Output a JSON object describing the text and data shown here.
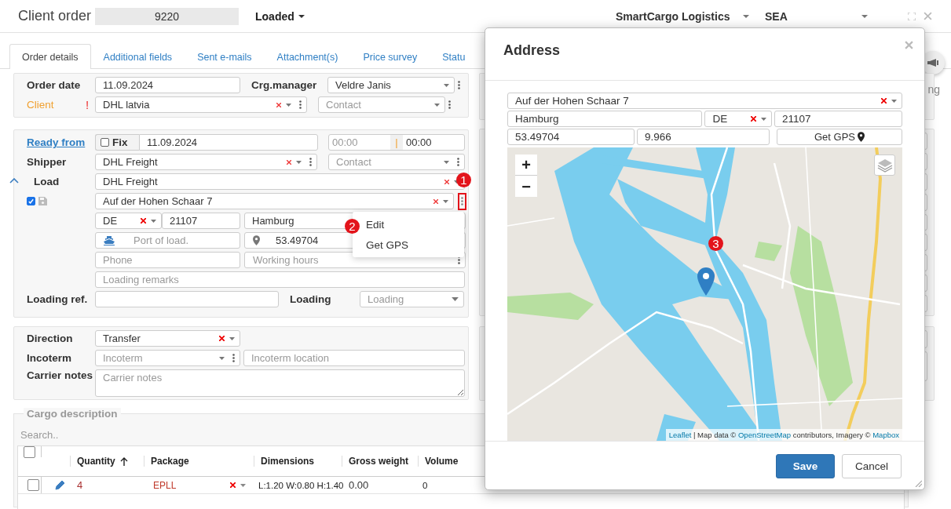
{
  "header": {
    "title": "Client order",
    "order_number": "9220",
    "status": "Loaded",
    "company": "SmartCargo Logistics",
    "mode": "SEA"
  },
  "tabs": [
    {
      "label": "Order details",
      "selected": true
    },
    {
      "label": "Additional fields",
      "selected": false
    },
    {
      "label": "Sent e-mails",
      "selected": false
    },
    {
      "label": "Attachment(s)",
      "selected": false
    },
    {
      "label": "Price survey",
      "selected": false
    },
    {
      "label": "Statu",
      "selected": false
    }
  ],
  "order": {
    "order_date_label": "Order date",
    "order_date": "11.09.2024",
    "manager_label": "Crg.manager",
    "manager": "Veldre Janis",
    "client_label": "Client",
    "client_required_mark": "!",
    "client": "DHL latvia",
    "contact_placeholder": "Contact"
  },
  "loading": {
    "ready_from_label": "Ready from",
    "fix_label": "Fix",
    "fix_checked": false,
    "ready_date": "11.09.2024",
    "time_from_placeholder": "00:00",
    "time_separator": "|",
    "time_to": "00:00",
    "shipper_label": "Shipper",
    "shipper": "DHL Freight",
    "shipper_contact_placeholder": "Contact",
    "load_label": "Load",
    "load": "DHL Freight",
    "address_checked": true,
    "address": "Auf der Hohen Schaar 7",
    "address_menu_highlighted": true,
    "country": "DE",
    "postcode": "21107",
    "city": "Hamburg",
    "port_placeholder": "Port of load.",
    "gps": "53.49704",
    "phone_placeholder": "Phone",
    "hours_placeholder": "Working hours",
    "remarks_placeholder": "Loading remarks",
    "ref_label": "Loading ref.",
    "loading_label": "Loading",
    "loading_placeholder": "Loading"
  },
  "context_menu": {
    "items": [
      "Edit",
      "Get GPS"
    ]
  },
  "transport": {
    "direction_label": "Direction",
    "direction": "Transfer",
    "incoterm_label": "Incoterm",
    "incoterm_placeholder": "Incoterm",
    "incoterm_location_placeholder": "Incoterm location",
    "notes_label": "Carrier notes",
    "notes_placeholder": "Carrier notes"
  },
  "side": {
    "text": "ng"
  },
  "cargo": {
    "legend": "Cargo description",
    "search_placeholder": "Search..",
    "columns": [
      {
        "label": "Quantity",
        "sorted": true
      },
      {
        "label": "Package",
        "sorted": false
      },
      {
        "label": "Dimensions",
        "sorted": false
      },
      {
        "label": "Gross weight",
        "sorted": false
      },
      {
        "label": "Volume",
        "sorted": false
      }
    ],
    "all_selected": false,
    "rows": [
      {
        "selected": false,
        "quantity": "4",
        "package": "EPLL",
        "dimensions": "L:1.20 W:0.80 H:1.40",
        "gross_weight": "0.00",
        "volume": "0"
      }
    ]
  },
  "modal": {
    "title": "Address",
    "address": "Auf der Hohen Schaar 7",
    "city": "Hamburg",
    "country": "DE",
    "postcode": "21107",
    "lat": "53.49704",
    "lng": "9.966",
    "gps_button": "Get GPS",
    "map": {
      "kind": "picture",
      "zoom_in": "+",
      "zoom_out": "−",
      "attribution": [
        {
          "text": "Leaflet",
          "link": true
        },
        {
          "text": " | Map data © ",
          "link": false
        },
        {
          "text": "OpenStreetMap",
          "link": true
        },
        {
          "text": " contributors, Imagery © ",
          "link": false
        },
        {
          "text": "Mapbox",
          "link": true
        }
      ]
    },
    "buttons": [
      {
        "label": "Save",
        "kind": "primary"
      },
      {
        "label": "Cancel",
        "kind": "default"
      }
    ]
  },
  "callouts": [
    {
      "label": "1"
    },
    {
      "label": "2"
    },
    {
      "label": "3"
    }
  ]
}
